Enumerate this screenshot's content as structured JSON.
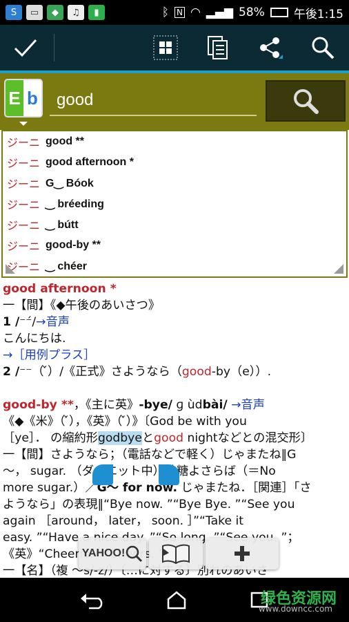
{
  "status": {
    "battery": "58%",
    "time": "午後1:15"
  },
  "search": {
    "value": "good",
    "logo_e": "E",
    "logo_b": "b"
  },
  "suggestions": [
    {
      "source": "ジーニ",
      "word": "good **"
    },
    {
      "source": "ジーニ",
      "word": "good afternoon *"
    },
    {
      "source": "ジーニ",
      "word": "G‿ Bóok"
    },
    {
      "source": "ジーニ",
      "word": "‿ bréeding"
    },
    {
      "source": "ジーニ",
      "word": "‿ bútt"
    },
    {
      "source": "ジーニ",
      "word": "good-by **"
    },
    {
      "source": "ジーニ",
      "word": "‿ chéer"
    }
  ],
  "entry": {
    "l1_head": "good afternoon *",
    "l2": "一【間】《◆午後のあいさつ》",
    "l3_num": "1 /",
    "l3_pron": "⁻⁻́/",
    "l3_link": "→音声",
    "l4": "こんにちは.",
    "l5_link": "→［用例プラス］",
    "l6_a": "2 /",
    "l6_b": "⁻⁻（ ̀́）/《正式》さようなら（",
    "l6_red": "good",
    "l6_c": "-by（e））.",
    "l8_head": "good-by **",
    "l8_a": "，《主に英》",
    "l8_bold": "-bye/",
    "l8_pron": "ɡ ùd",
    "l8_pron_b": "bài/",
    "l8_link": "→音声",
    "l9": "《◆《米》（ ̀́），《英》（ ̀́）》〔God be with you",
    "l10_a": "［ye］． の縮約形",
    "l10_hl": "godbye",
    "l10_b": "と",
    "l10_red": "good",
    "l10_c": " nightなどとの混交形〕",
    "l11": "一【間】さようなら；（電話などで軽く）じゃまたね‖G",
    "l12_a": "〜， sugar.  （ダイエット中）砂糖よさらば（＝No",
    "l13_a": "more sugar.）／",
    "l13_bold": "G〜 for now.",
    "l13_b": "  じゃまたね．［関連］「さ",
    "l14": "ようなら」の表現‖“Bye now. ”“Bye Bye. ”“See you",
    "l15": "again ［around， later， soon. ］”“Take it",
    "l16": "easy. ”“Have a nice day. ”“So long. ”“See you. ”；",
    "l17": "《英》“Cheerio. ”“Cheers. ”",
    "l18": "一【名】（複 〜s/-z/）〔…に対する〕別れのあいさ"
  },
  "fabs": {
    "yahoo": "YAHOO!"
  },
  "watermark": {
    "main": "绿色资源网",
    "url": "www.downcc.com"
  }
}
